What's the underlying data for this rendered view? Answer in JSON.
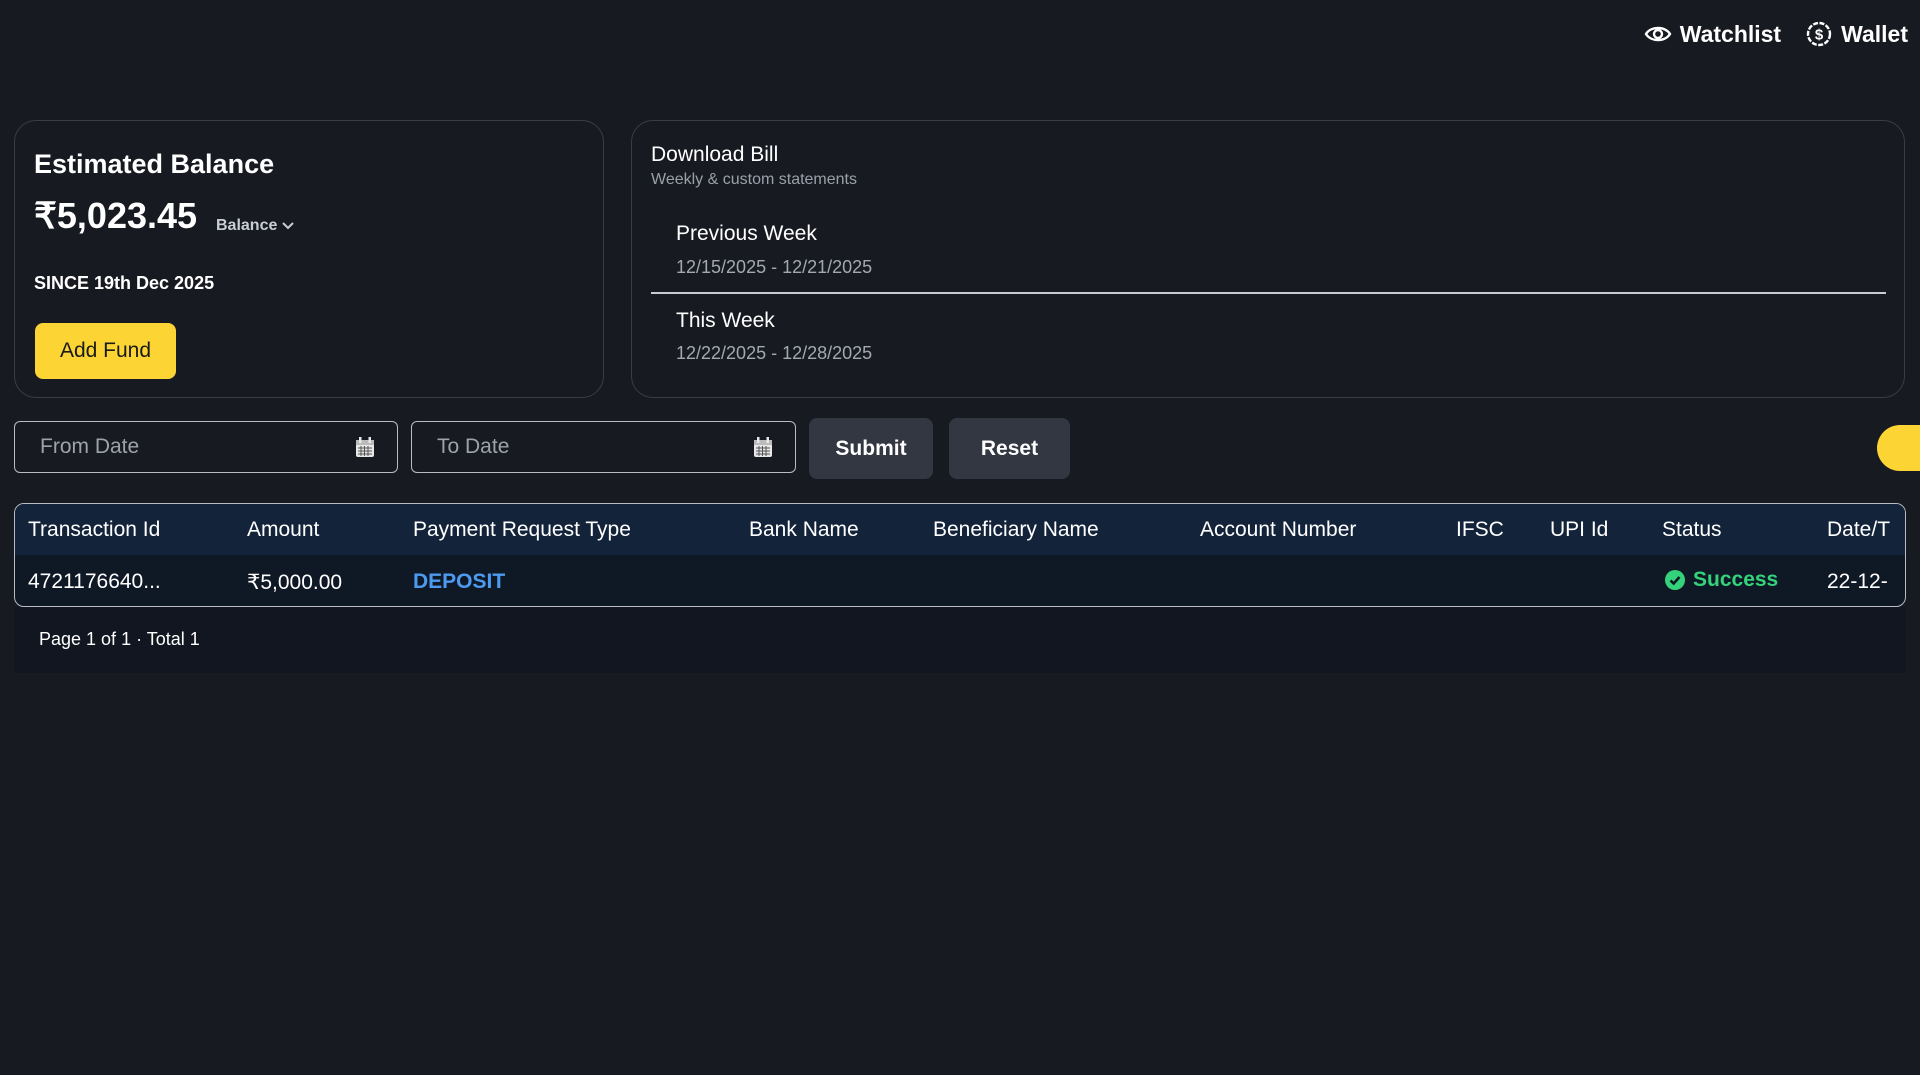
{
  "topnav": {
    "watchlist": "Watchlist",
    "wallet": "Wallet"
  },
  "balance_card": {
    "title": "Estimated Balance",
    "amount": "₹5,023.45",
    "balance_dropdown": "Balance",
    "since": "SINCE 19th Dec 2025",
    "add_fund": "Add Fund"
  },
  "bill_card": {
    "title": "Download Bill",
    "subtitle": "Weekly & custom statements",
    "weeks": [
      {
        "label": "Previous Week",
        "range": "12/15/2025 - 12/21/2025"
      },
      {
        "label": "This Week",
        "range": "12/22/2025 - 12/28/2025"
      }
    ]
  },
  "filters": {
    "from_placeholder": "From Date",
    "to_placeholder": "To Date",
    "submit": "Submit",
    "reset": "Reset"
  },
  "table": {
    "columns": [
      "Transaction Id",
      "Amount",
      "Payment Request Type",
      "Bank Name",
      "Beneficiary Name",
      "Account Number",
      "IFSC",
      "UPI Id",
      "Status",
      "Date/T"
    ],
    "rows": [
      {
        "transaction_id": "4721176640...",
        "amount": "₹5,000.00",
        "type": "DEPOSIT",
        "bank_name": "",
        "beneficiary": "",
        "account_number": "",
        "ifsc": "",
        "upi": "",
        "status": "Success",
        "date": "22-12-"
      }
    ]
  },
  "pagination": {
    "text": "Page 1 of 1 · Total 1"
  },
  "colors": {
    "accent": "#fcd535",
    "background": "#181a21",
    "deposit": "#4d9bf0",
    "success": "#34d27a"
  }
}
